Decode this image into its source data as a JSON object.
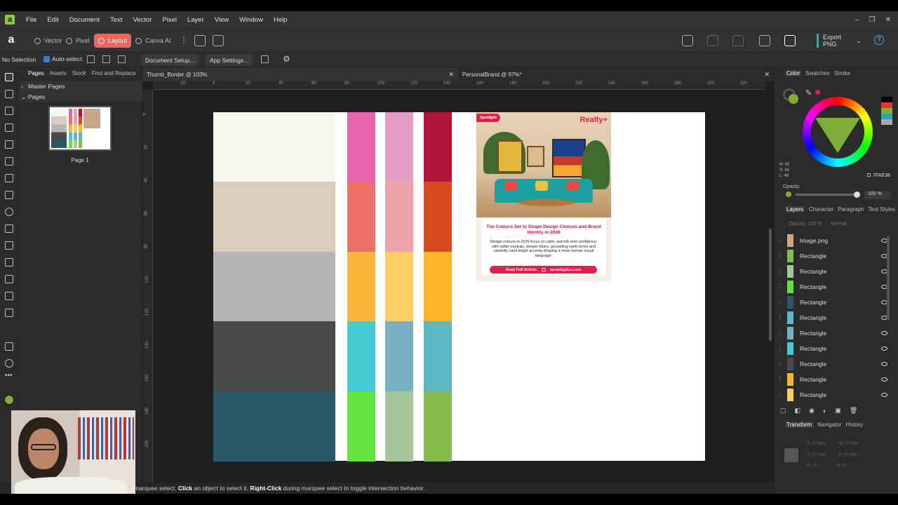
{
  "menubar": {
    "items": [
      "File",
      "Edit",
      "Document",
      "Text",
      "Vector",
      "Pixel",
      "Layer",
      "View",
      "Window",
      "Help"
    ],
    "window_controls": [
      "–",
      "❐",
      "✕"
    ]
  },
  "toolbar": {
    "personas": [
      "Vector",
      "Pixel",
      "Layout",
      "Canva AI"
    ],
    "active_persona": "Layout",
    "export_label": "Export PNG",
    "help": "?"
  },
  "context": {
    "selection": "No Selection",
    "autoselect": "Auto-select:",
    "document_setup": "Document Setup...",
    "app_settings": "App Settings..."
  },
  "pages_panel": {
    "tabs": [
      "Pages",
      "Assets",
      "Stock",
      "Find and Replace"
    ],
    "master_pages": "Master Pages",
    "pages": "Pages",
    "page_label": "Page 1"
  },
  "doc_tabs": [
    {
      "title": "Thumb_Border @ 103%"
    },
    {
      "title": "PersonalBrand @ 97%*"
    }
  ],
  "ruler": {
    "h_ticks": [
      "-20",
      "0",
      "20",
      "40",
      "60",
      "80",
      "100",
      "120",
      "140",
      "160",
      "180",
      "200",
      "220",
      "240",
      "260",
      "280",
      "300",
      "320"
    ],
    "v_ticks": [
      "0",
      "20",
      "40",
      "60",
      "80",
      "100",
      "120",
      "140",
      "160",
      "180",
      "200"
    ]
  },
  "swatches": {
    "column1": [
      "#f8f6f1",
      "#dacdbe",
      "#b5b5b5",
      "#4a4a4a",
      "#2a5767"
    ],
    "column2": [
      "#e763ab",
      "#ec7168",
      "#fbb63c",
      "#45ccd3",
      "#62e33d"
    ],
    "column3": [
      "#e39ec4",
      "#eca3a7",
      "#fbcd64",
      "#79b0c1",
      "#a6c79b"
    ],
    "column4": [
      "#b01239",
      "#d54a21",
      "#fbb62a",
      "#5cb8c2",
      "#86bb4e"
    ]
  },
  "poster": {
    "badge": "Spotlight",
    "brand": "Realty+",
    "title": "The Colours Set to Shape Design Choices and Brand Identity in 2026",
    "body": "Design colours in 2026 focus on calm, warmth and confidence, with softer neutrals, deeper blues, grounding earth tones and carefully used bright accents shaping a more human visual language.",
    "cta_label": "Read Full Article:",
    "cta_url": "rprealtyplus.com"
  },
  "status": {
    "prefix": "marquee select. ",
    "click": "Click",
    "mid": " an object to select it. ",
    "rightclick": "Right-Click",
    "suffix": " during marquee select to toggle intersection behavior."
  },
  "color_panel": {
    "tabs": [
      "Color",
      "Swatches",
      "Stroke"
    ],
    "hsl": [
      "H: 85",
      "S: 49",
      "L: 48"
    ],
    "hex": "7FAE38",
    "opacity_label": "Opacity",
    "opacity_value": "100 %",
    "current_color": "#7fae38"
  },
  "layers_panel": {
    "tabs": [
      "Layers",
      "Character",
      "Paragraph",
      "Text Styles"
    ],
    "opacity": "Opacity: 100 %",
    "blend": "Normal",
    "layers": [
      {
        "name": "Image.png",
        "color": "#c9a78a"
      },
      {
        "name": "Rectangle",
        "color": "#86bb4e"
      },
      {
        "name": "Rectangle",
        "color": "#a6c79b"
      },
      {
        "name": "Rectangle",
        "color": "#62e33d"
      },
      {
        "name": "Rectangle",
        "color": "#2a5767"
      },
      {
        "name": "Rectangle",
        "color": "#5cb8c2"
      },
      {
        "name": "Rectangle",
        "color": "#79b0c1"
      },
      {
        "name": "Rectangle",
        "color": "#45ccd3"
      },
      {
        "name": "Rectangle",
        "color": "#4a4a4a"
      },
      {
        "name": "Rectangle",
        "color": "#fbb62a"
      },
      {
        "name": "Rectangle",
        "color": "#fbcd64"
      }
    ]
  },
  "bottom_panel": {
    "tabs": [
      "Transform",
      "Navigator",
      "History"
    ],
    "fields": [
      "X: 0 mm",
      "W: 0 mm",
      "Y: 0 mm",
      "H: 0 mm",
      "R: 0 °",
      "S: 0 °"
    ]
  }
}
